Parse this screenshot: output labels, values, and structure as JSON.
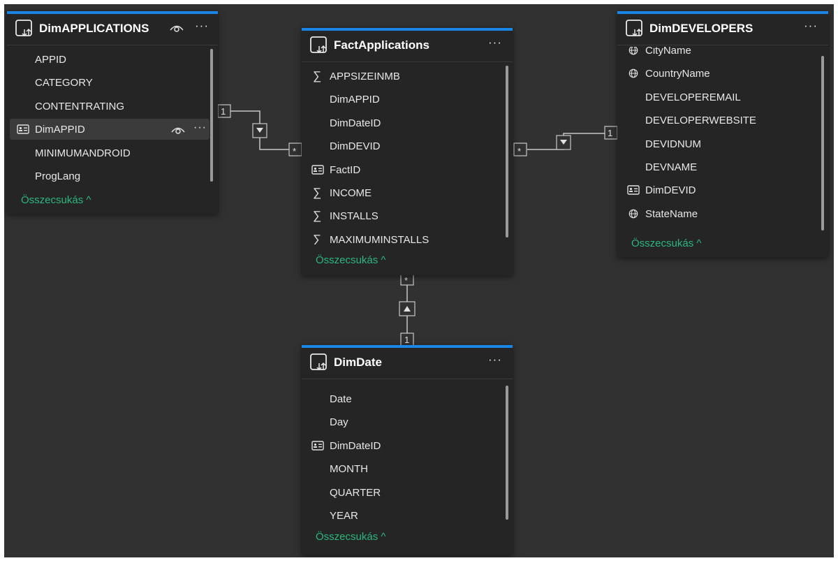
{
  "tables": {
    "dim_applications": {
      "title": "DimAPPLICATIONS",
      "fields": [
        {
          "label": "APPID",
          "icon": "none"
        },
        {
          "label": "CATEGORY",
          "icon": "none"
        },
        {
          "label": "CONTENTRATING",
          "icon": "none"
        },
        {
          "label": "DimAPPID",
          "icon": "id-card-icon"
        },
        {
          "label": "MINIMUMANDROID",
          "icon": "none"
        },
        {
          "label": "ProgLang",
          "icon": "none"
        }
      ],
      "collapse_label": "Összecsukás ^"
    },
    "fact_applications": {
      "title": "FactApplications",
      "fields": [
        {
          "label": "APPSIZEINMB",
          "icon": "sigma-icon"
        },
        {
          "label": "DimAPPID",
          "icon": "none"
        },
        {
          "label": "DimDateID",
          "icon": "none"
        },
        {
          "label": "DimDEVID",
          "icon": "none"
        },
        {
          "label": "FactID",
          "icon": "id-card-icon"
        },
        {
          "label": "INCOME",
          "icon": "sigma-icon"
        },
        {
          "label": "INSTALLS",
          "icon": "sigma-icon"
        },
        {
          "label": "MAXIMUMINSTALLS",
          "icon": "sigma-icon"
        }
      ],
      "collapse_label": "Összecsukás ^"
    },
    "dim_developers": {
      "title": "DimDEVELOPERS",
      "fields": [
        {
          "label": "CityName",
          "icon": "globe-icon"
        },
        {
          "label": "CountryName",
          "icon": "globe-icon"
        },
        {
          "label": "DEVELOPEREMAIL",
          "icon": "none"
        },
        {
          "label": "DEVELOPERWEBSITE",
          "icon": "none"
        },
        {
          "label": "DEVIDNUM",
          "icon": "none"
        },
        {
          "label": "DEVNAME",
          "icon": "none"
        },
        {
          "label": "DimDEVID",
          "icon": "id-card-icon"
        },
        {
          "label": "StateName",
          "icon": "globe-icon"
        }
      ],
      "collapse_label": "Összecsukás ^"
    },
    "dim_date": {
      "title": "DimDate",
      "fields": [
        {
          "label": "Date",
          "icon": "none"
        },
        {
          "label": "Day",
          "icon": "none"
        },
        {
          "label": "DimDateID",
          "icon": "id-card-icon"
        },
        {
          "label": "MONTH",
          "icon": "none"
        },
        {
          "label": "QUARTER",
          "icon": "none"
        },
        {
          "label": "YEAR",
          "icon": "none"
        }
      ],
      "collapse_label": "Összecsukás ^"
    }
  },
  "more_label": "···",
  "relationships": {
    "one_label": "1",
    "many_label": "*"
  },
  "colors": {
    "canvas": "#313131",
    "card": "#252525",
    "accent": "#1a86e8",
    "collapse_link": "#2bb77f"
  }
}
